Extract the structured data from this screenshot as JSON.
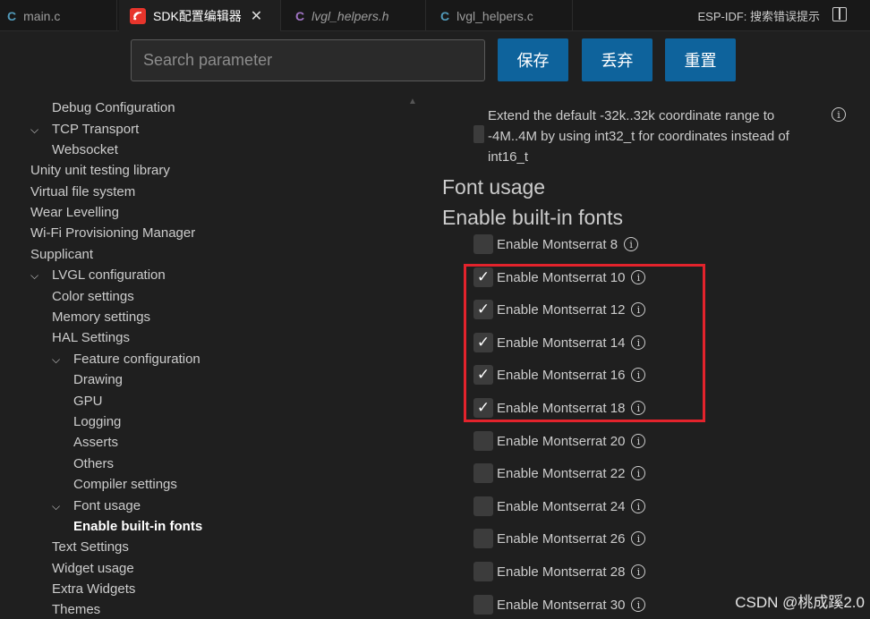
{
  "tabs": [
    {
      "icon": "C",
      "label": "main.c"
    },
    {
      "icon": "sdk",
      "label": "SDK配置编辑器",
      "close": "✕"
    },
    {
      "icon": "C",
      "label": "lvgl_helpers.h"
    },
    {
      "icon": "C",
      "label": "lvgl_helpers.c"
    }
  ],
  "status": {
    "espidf": "ESP-IDF:  搜索错误提示"
  },
  "search": {
    "placeholder": "Search parameter"
  },
  "buttons": {
    "save": "保存",
    "discard": "丢弃",
    "reset": "重置"
  },
  "tree": [
    {
      "label": "Debug Configuration"
    },
    {
      "label": "TCP Transport",
      "expanded": true
    },
    {
      "label": "Websocket"
    },
    {
      "label": "Unity unit testing library"
    },
    {
      "label": "Virtual file system"
    },
    {
      "label": "Wear Levelling"
    },
    {
      "label": "Wi-Fi Provisioning Manager"
    },
    {
      "label": "Supplicant"
    },
    {
      "label": "LVGL configuration",
      "expanded": true
    },
    {
      "label": "Color settings"
    },
    {
      "label": "Memory settings"
    },
    {
      "label": "HAL Settings"
    },
    {
      "label": "Feature configuration",
      "expanded": true
    },
    {
      "label": "Drawing"
    },
    {
      "label": "GPU"
    },
    {
      "label": "Logging"
    },
    {
      "label": "Asserts"
    },
    {
      "label": "Others"
    },
    {
      "label": "Compiler settings"
    },
    {
      "label": "Font usage",
      "expanded": true
    },
    {
      "label": "Enable built-in fonts",
      "selected": true
    },
    {
      "label": "Text Settings"
    },
    {
      "label": "Widget usage"
    },
    {
      "label": "Extra Widgets"
    },
    {
      "label": "Themes"
    }
  ],
  "panel": {
    "description": "Extend the default -32k..32k coordinate range to -4M..4M by using int32_t for coordinates instead of int16_t",
    "section1": "Font usage",
    "section2": "Enable built-in fonts",
    "options": [
      {
        "label": "Enable Montserrat 8",
        "checked": false
      },
      {
        "label": "Enable Montserrat 10",
        "checked": true
      },
      {
        "label": "Enable Montserrat 12",
        "checked": true
      },
      {
        "label": "Enable Montserrat 14",
        "checked": true
      },
      {
        "label": "Enable Montserrat 16",
        "checked": true
      },
      {
        "label": "Enable Montserrat 18",
        "checked": true
      },
      {
        "label": "Enable Montserrat 20",
        "checked": false
      },
      {
        "label": "Enable Montserrat 22",
        "checked": false
      },
      {
        "label": "Enable Montserrat 24",
        "checked": false
      },
      {
        "label": "Enable Montserrat 26",
        "checked": false
      },
      {
        "label": "Enable Montserrat 28",
        "checked": false
      },
      {
        "label": "Enable Montserrat 30",
        "checked": false
      }
    ]
  },
  "watermark": "CSDN @桃成蹊2.0",
  "colors": {
    "accent_button": "#0e639c",
    "highlight_box": "#e3232c",
    "c_icon": "#519aba",
    "h_icon": "#a074c4",
    "sdk_icon": "#e7352c"
  }
}
